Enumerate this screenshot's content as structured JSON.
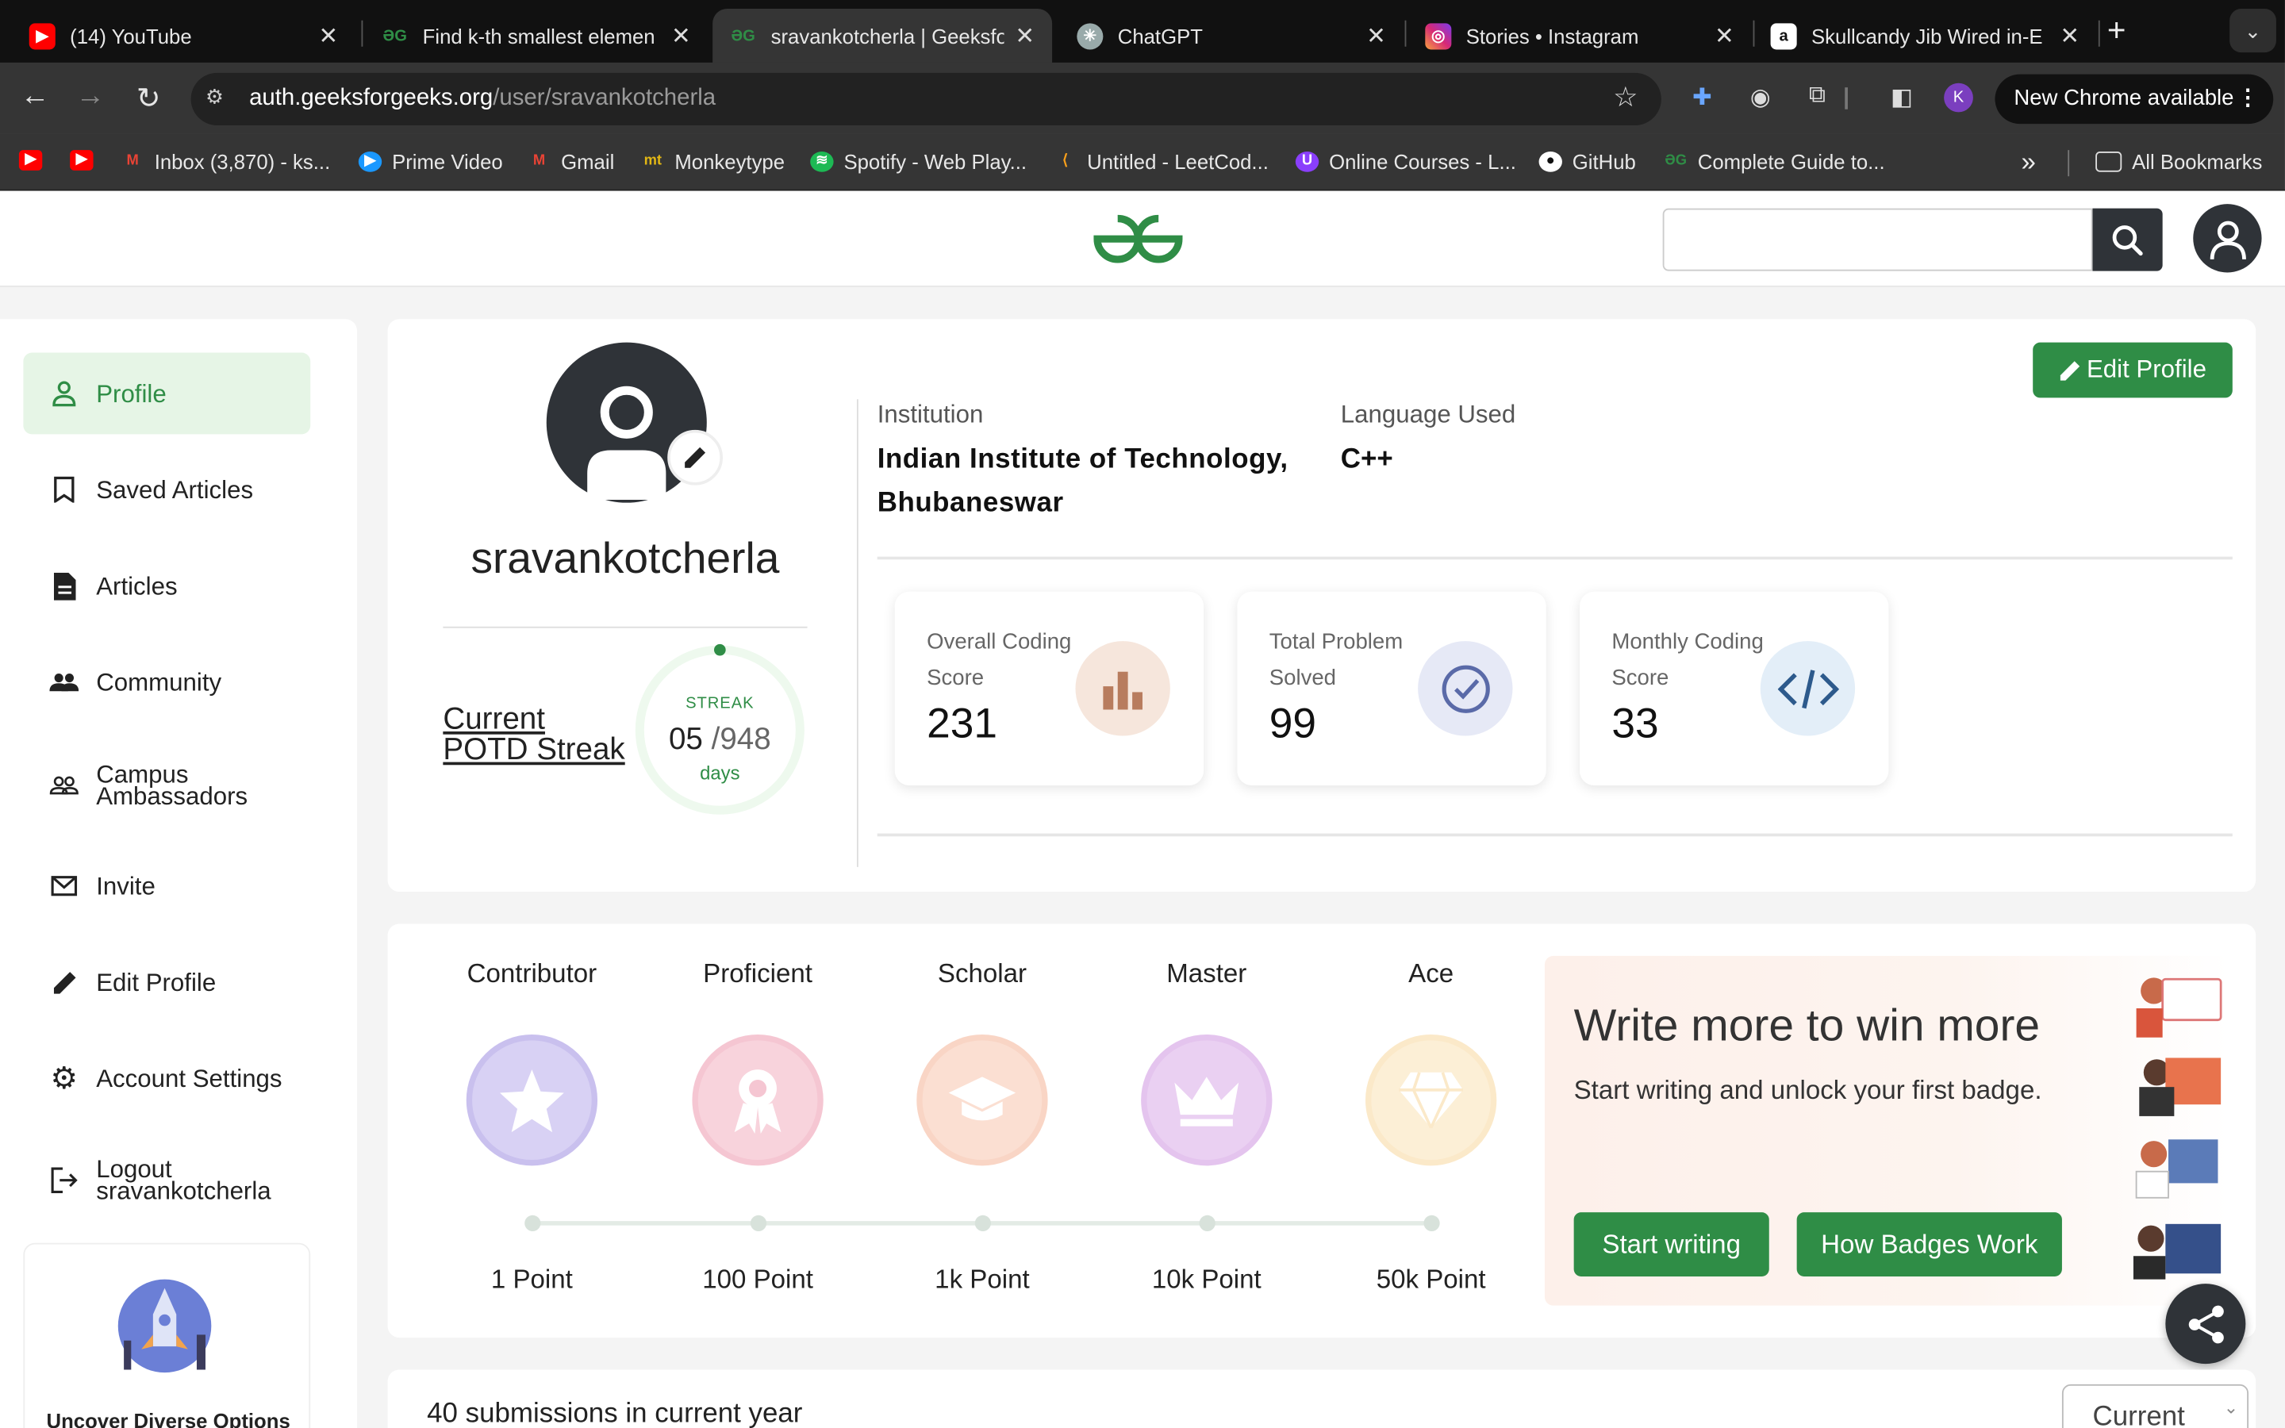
{
  "browser": {
    "tabs": [
      {
        "title": "(14) YouTube",
        "icon": "youtube-icon",
        "active": false
      },
      {
        "title": "Find k-th smallest elemen",
        "icon": "gfg-icon",
        "active": false
      },
      {
        "title": "sravankotcherla | Geeksfo",
        "icon": "gfg-icon",
        "active": true
      },
      {
        "title": "ChatGPT",
        "icon": "chatgpt-icon",
        "active": false
      },
      {
        "title": "Stories • Instagram",
        "icon": "instagram-icon",
        "active": false
      },
      {
        "title": "Skullcandy Jib Wired in-E",
        "icon": "amazon-icon",
        "active": false
      }
    ],
    "new_tab_label": "+",
    "tab_close": "✕",
    "url_host": "auth.geeksforgeeks.org",
    "url_path": "/user/sravankotcherla",
    "profile_initial": "K",
    "update_label": "New Chrome available",
    "bookmarks": [
      {
        "label": "",
        "icon": "youtube-icon"
      },
      {
        "label": "",
        "icon": "youtube-icon"
      },
      {
        "label": "Inbox (3,870) - ks...",
        "icon": "gmail-icon"
      },
      {
        "label": "Prime Video",
        "icon": "prime-video-icon"
      },
      {
        "label": "Gmail",
        "icon": "gmail-icon"
      },
      {
        "label": "Monkeytype",
        "icon": "monkeytype-icon"
      },
      {
        "label": "Spotify - Web Play...",
        "icon": "spotify-icon"
      },
      {
        "label": "Untitled - LeetCod...",
        "icon": "leetcode-icon"
      },
      {
        "label": "Online Courses - L...",
        "icon": "courses-icon"
      },
      {
        "label": "GitHub",
        "icon": "github-icon"
      },
      {
        "label": "Complete Guide to...",
        "icon": "gfg-icon"
      }
    ],
    "all_bookmarks": "All Bookmarks"
  },
  "sidebar": {
    "items": [
      {
        "label": "Profile",
        "icon": "person-icon"
      },
      {
        "label": "Saved Articles",
        "icon": "bookmark-icon"
      },
      {
        "label": "Articles",
        "icon": "document-icon"
      },
      {
        "label": "Community",
        "icon": "group-icon"
      },
      {
        "label": "Campus Ambassadors",
        "icon": "people-outline-icon"
      },
      {
        "label": "Invite",
        "icon": "mail-icon"
      },
      {
        "label": "Edit Profile",
        "icon": "pencil-icon"
      },
      {
        "label": "Account Settings",
        "icon": "gear-icon"
      },
      {
        "label": "Logout sravankotcherla",
        "icon": "logout-icon"
      }
    ],
    "promo_text": "Uncover Diverse Options"
  },
  "profile": {
    "username": "sravankotcherla",
    "potd_label": "Current POTD Streak",
    "streak_label": "STREAK",
    "streak_current": "05",
    "streak_total": "/948",
    "streak_unit": "days",
    "institution_label": "Institution",
    "institution": "Indian Institute of Technology, Bhubaneswar",
    "language_label": "Language Used",
    "language": "C++",
    "edit_button": "Edit Profile",
    "stats": [
      {
        "label": "Overall Coding Score",
        "value": "231",
        "icon": "bar-chart-icon",
        "color": "#f6e6dc"
      },
      {
        "label": "Total Problem Solved",
        "value": "99",
        "icon": "check-circle-icon",
        "color": "#e6e9f6"
      },
      {
        "label": "Monthly Coding Score",
        "value": "33",
        "icon": "code-icon",
        "color": "#e3eef8"
      }
    ]
  },
  "badges": {
    "items": [
      {
        "name": "Contributor",
        "points": "1 Point",
        "icon": "star-badge-icon",
        "color": "#c9c0ee"
      },
      {
        "name": "Proficient",
        "points": "100 Point",
        "icon": "ribbon-badge-icon",
        "color": "#f5c6d2"
      },
      {
        "name": "Scholar",
        "points": "1k Point",
        "icon": "graduation-cap-icon",
        "color": "#f9d5c5"
      },
      {
        "name": "Master",
        "points": "10k Point",
        "icon": "crown-badge-icon",
        "color": "#e4c4ee"
      },
      {
        "name": "Ace",
        "points": "50k Point",
        "icon": "diamond-badge-icon",
        "color": "#fbe9c9"
      }
    ],
    "promo_title": "Write more to win more",
    "promo_subtitle": "Start writing and unlock your first badge.",
    "start_writing": "Start writing",
    "how_badges": "How Badges Work"
  },
  "submissions": {
    "title": "40 submissions in current year",
    "period_select": "Current"
  },
  "colors": {
    "brand_green": "#2f8d46",
    "dark": "#2f3338"
  }
}
